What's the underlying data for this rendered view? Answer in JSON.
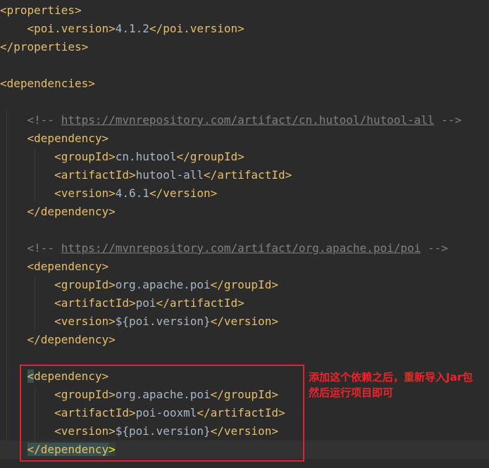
{
  "code": {
    "properties_open": "<properties>",
    "poi_version_open": "<poi.version>",
    "poi_version_value": "4.1.2",
    "poi_version_close": "</poi.version>",
    "properties_close": "</properties>",
    "dependencies_open": "<dependencies>",
    "comment1_prefix": "<!-- ",
    "comment1_url": "https://mvnrepository.com/artifact/cn.hutool/hutool-all",
    "comment1_suffix": " -->",
    "dep1": {
      "open": "<dependency>",
      "groupId_open": "<groupId>",
      "groupId": "cn.hutool",
      "groupId_close": "</groupId>",
      "artifactId_open": "<artifactId>",
      "artifactId": "hutool-all",
      "artifactId_close": "</artifactId>",
      "version_open": "<version>",
      "version": "4.6.1",
      "version_close": "</version>",
      "close": "</dependency>"
    },
    "comment2_prefix": "<!-- ",
    "comment2_url": "https://mvnrepository.com/artifact/org.apache.poi/poi",
    "comment2_suffix": " -->",
    "dep2": {
      "open": "<dependency>",
      "groupId_open": "<groupId>",
      "groupId": "org.apache.poi",
      "groupId_close": "</groupId>",
      "artifactId_open": "<artifactId>",
      "artifactId": "poi",
      "artifactId_close": "</artifactId>",
      "version_open": "<version>",
      "version": "${poi.version}",
      "version_close": "</version>",
      "close": "</dependency>"
    },
    "dep3": {
      "open_lt": "<",
      "open_name": "dependency",
      "open_gt": ">",
      "groupId_open": "<groupId>",
      "groupId": "org.apache.poi",
      "groupId_close": "</groupId>",
      "artifactId_open": "<artifactId>",
      "artifactId": "poi-ooxml",
      "artifactId_close": "</artifactId>",
      "version_open": "<version>",
      "version": "${poi.version}",
      "version_close": "</version>",
      "close_lt": "</",
      "close_name": "dependency",
      "close_gt": ">"
    }
  },
  "annotation": {
    "line1": "添加这个依赖之后，重新导入Jar包",
    "line2": "然后运行项目即可",
    "color": "#f0232b"
  }
}
